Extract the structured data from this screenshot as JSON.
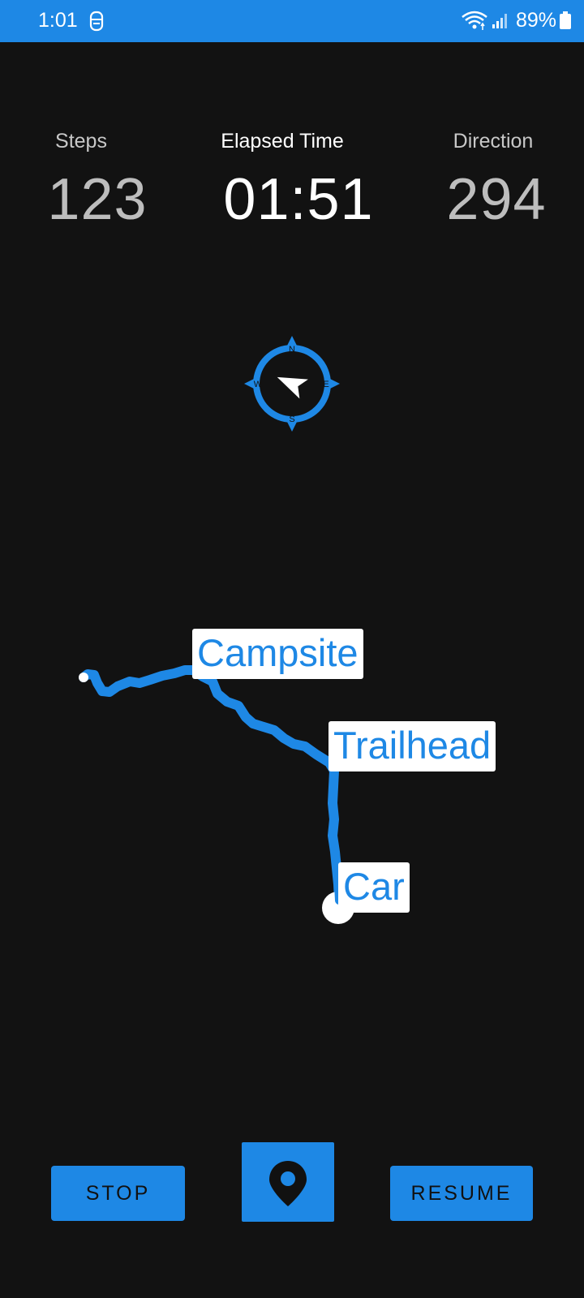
{
  "status_bar": {
    "time": "1:01",
    "battery": "89%",
    "icons": [
      "app-notification-icon",
      "wifi-icon",
      "signal-icon",
      "battery-icon"
    ]
  },
  "stats": {
    "steps_label": "Steps",
    "steps_value": "123",
    "time_label": "Elapsed Time",
    "time_value": "01:51",
    "direction_label": "Direction",
    "direction_value": "294"
  },
  "compass": {
    "icon": "compass-icon",
    "north": "N",
    "east": "E",
    "south": "S",
    "west": "W"
  },
  "waypoints": [
    {
      "label": "Campsite"
    },
    {
      "label": "Trailhead"
    },
    {
      "label": "Car"
    }
  ],
  "buttons": {
    "stop": "STOP",
    "resume": "RESUME",
    "marker_icon": "map-pin-icon"
  },
  "colors": {
    "accent": "#1e88e5",
    "background": "#121212"
  }
}
